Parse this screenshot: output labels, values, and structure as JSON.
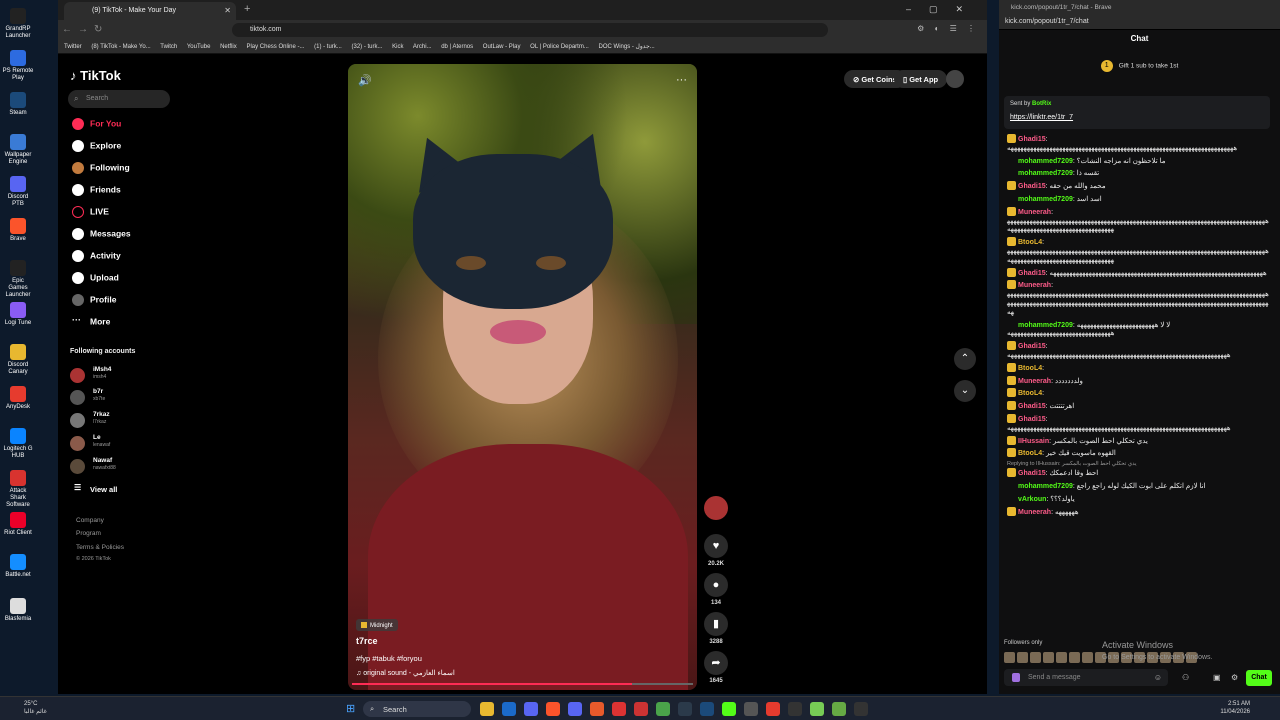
{
  "desktop": {
    "icons": [
      "GrandRP Launcher",
      "PS Remote Play",
      "Steam",
      "Wallpaper Engine",
      "Discord PTB",
      "Brave",
      "Epic Games Launcher",
      "Logi Tune",
      "Discord Canary",
      "AnyDesk",
      "Logitech G HUB",
      "Attack Shark Software",
      "Riot Client",
      "Battle.net",
      "Blasfemia"
    ]
  },
  "browser": {
    "tab_title": "(9) TikTok - Make Your Day",
    "url": "tiktok.com",
    "bookmarks": [
      "Twitter",
      "(8) TikTok - Make Yo...",
      "Twitch",
      "YouTube",
      "Netflix",
      "Play Chess Online -...",
      "(1) - turk...",
      "(32) - turk...",
      "Kick",
      "Archi...",
      "db | Aternos",
      "OutLaw - Play",
      "OL | Police Departm...",
      "DOC Wings - جدول..."
    ]
  },
  "tiktok": {
    "logo": "TikTok",
    "search_placeholder": "Search",
    "nav": [
      "For You",
      "Explore",
      "Following",
      "Friends",
      "LIVE",
      "Messages",
      "Activity",
      "Upload",
      "Profile",
      "More"
    ],
    "following_title": "Following accounts",
    "accounts": [
      {
        "name": "iMsh4",
        "handle": "imsh4"
      },
      {
        "name": "b7r",
        "handle": "xb7te"
      },
      {
        "name": "7rkaz",
        "handle": "l7rkaz"
      },
      {
        "name": "Le",
        "handle": "lenawaf"
      },
      {
        "name": "Nawaf",
        "handle": "nawafxt88"
      }
    ],
    "view_all": "View all",
    "footer": [
      "Company",
      "Program",
      "Terms & Policies",
      "© 2026 TikTok"
    ],
    "get_coins": "Get Coins",
    "get_app": "Get App",
    "video": {
      "tag": "Midnight",
      "username": "t7rce",
      "hashtags": "#fyp #tabuk #foryou",
      "sound": "original sound - اسماء العازمي",
      "progress": 0.82,
      "likes": "20.2K",
      "comments": "134",
      "saves": "3288",
      "shares": "1645"
    }
  },
  "kick": {
    "window_title": "kick.com/popout/1tr_7/chat - Brave",
    "url": "kick.com/popout/1tr_7/chat",
    "header": "Chat",
    "gift_text": "Gift 1 sub to take 1st",
    "pinned_sent_by": "Sent by",
    "pinned_bot": "BotRix",
    "pinned_link": "https://linktr.ee/1tr_7",
    "messages": [
      {
        "user": "Ghadi15",
        "color": "#ff5c8a",
        "text": "ههههههههههههههههههههههههههههههههههههههههههههههههههههههههههههههههههههههه"
      },
      {
        "user": "mohammed7209",
        "color": "#53fc18",
        "text": "ما تلاحظون انه مزاجه النشات؟"
      },
      {
        "user": "mohammed7209",
        "color": "#53fc18",
        "text": "تقسه ذا"
      },
      {
        "user": "Ghadi15",
        "color": "#ff5c8a",
        "text": "محمد والله من حقه"
      },
      {
        "user": "mohammed7209",
        "color": "#53fc18",
        "text": "اسد اسد"
      },
      {
        "user": "Muneerah",
        "color": "#ff5c8a",
        "text": "هههههههههههههههههههههههههههههههههههههههههههههههههههههههههههههههههههههههههههههههههههههههههههههههههههههههههههههههههه"
      },
      {
        "user": "BtooL4",
        "color": "#e8b830",
        "text": "هههههههههههههههههههههههههههههههههههههههههههههههههههههههههههههههههههههههههههههههههههههههههههههههههههههههههههههههههه"
      },
      {
        "user": "Ghadi15",
        "color": "#ff5c8a",
        "text": "ههههههههههههههههههههههههههههههههههههههههههههههههههههههههههههههههههه"
      },
      {
        "user": "Muneerah",
        "color": "#ff5c8a",
        "text": "هههههههههههههههههههههههههههههههههههههههههههههههههههههههههههههههههههههههههههههههههههههههههههههههههههههههههههههههههههههههههههههههههههههههههههههههههههههههههههههههههههه"
      },
      {
        "user": "mohammed7209",
        "color": "#53fc18",
        "text": "لا لا ههههههههههههههههههههههههه ههههههههههههههههههههههههههههههههه"
      },
      {
        "user": "Ghadi15",
        "color": "#ff5c8a",
        "text": "ههههههههههههههههههههههههههههههههههههههههههههههههههههههههههههههههههههه"
      },
      {
        "user": "BtooL4",
        "color": "#e8b830",
        "text": ""
      },
      {
        "user": "Muneerah",
        "color": "#ff5c8a",
        "text": "ولددددددد"
      },
      {
        "user": "BtooL4",
        "color": "#e8b830",
        "text": ""
      },
      {
        "user": "Ghadi15",
        "color": "#ff5c8a",
        "text": "اهرتتتتت"
      },
      {
        "user": "Ghadi15",
        "color": "#ff5c8a",
        "text": "ههههههههههههههههههههههههههههههههههههههههههههههههههههههههههههههههههههه"
      },
      {
        "user": "IIHussain",
        "color": "#ff5c8a",
        "text": "يدي تحكلي احط الصوت بالمكسر"
      },
      {
        "user": "BtooL4",
        "color": "#e8b830",
        "text": "القهوه ماسويت قيك خير"
      },
      {
        "user": "Ghadi15",
        "color": "#ff5c8a",
        "replying": "Replying to IIHussain: يدي تحكلي احط الصوت بالمكسر",
        "text": "احط وقا ادعمكك"
      },
      {
        "user": "mohammed7209",
        "color": "#53fc18",
        "text": "انا لازم اتكلم على ابوت الكيك لوله راجع راجع"
      },
      {
        "user": "vArkoun",
        "color": "#53fc18",
        "text": "ياولد؟؟؟"
      },
      {
        "user": "Muneerah",
        "color": "#ff5c8a",
        "text": "ههههههه"
      }
    ],
    "followers_only": "Followers only",
    "activate_title": "Activate Windows",
    "activate_sub": "Go to Settings to activate Windows.",
    "send_placeholder": "Send a message",
    "chat_button": "Chat"
  },
  "taskbar": {
    "search": "Search",
    "temp": "25°C",
    "weather_text": "غائم غالبا",
    "time": "2:51 AM",
    "date": "11/04/2026"
  }
}
